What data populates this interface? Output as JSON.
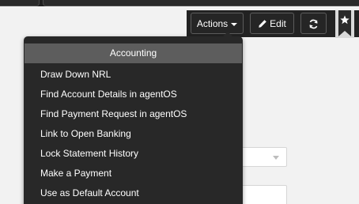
{
  "toolbar": {
    "actions_label": "Actions",
    "edit_label": "Edit",
    "refresh_icon": "refresh-icon",
    "bookmark_icon": "star-bookmark-icon"
  },
  "menu": {
    "header": "Accounting",
    "items": [
      "Draw Down NRL",
      "Find Account Details in agentOS",
      "Find Payment Request in agentOS",
      "Link to Open Banking",
      "Lock Statement History",
      "Make a Payment",
      "Use as Default Account"
    ]
  },
  "colors": {
    "toolbar_bg": "#222222",
    "menu_bg": "#282828",
    "menu_header_bg": "#5d5d5d",
    "page_bg": "#f2f2f2"
  }
}
